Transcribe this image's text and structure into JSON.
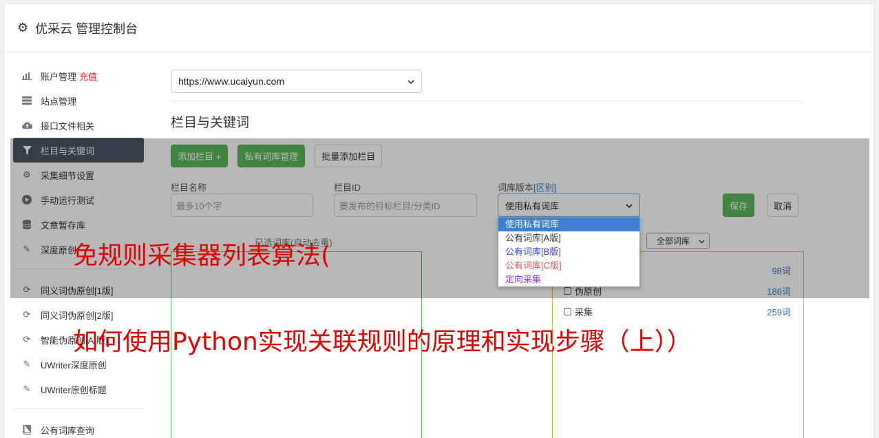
{
  "header": {
    "title": "优采云 管理控制台"
  },
  "sidebar": {
    "items": [
      {
        "label": "账户管理",
        "icon": "bar-chart-icon",
        "extra": "充值"
      },
      {
        "label": "站点管理",
        "icon": "server-icon"
      },
      {
        "label": "接口文件相关",
        "icon": "cloud-upload-icon"
      },
      {
        "label": "栏目与关键词",
        "icon": "filter-icon",
        "active": true
      },
      {
        "label": "采集细节设置",
        "icon": "cogs-icon"
      },
      {
        "label": "手动运行测试",
        "icon": "play-circle-icon"
      },
      {
        "label": "文章暂存库",
        "icon": "database-icon"
      },
      {
        "label": "深度原创",
        "icon": "edit-icon"
      }
    ],
    "items2": [
      {
        "label": "同义词伪原创[1版]",
        "icon": "refresh-icon"
      },
      {
        "label": "同义词伪原创[2版]",
        "icon": "refresh-icon"
      },
      {
        "label": "智能伪原创[AI版]",
        "icon": "refresh-icon"
      },
      {
        "label": "UWriter深度原创",
        "icon": "edit-icon"
      },
      {
        "label": "UWriter原创标题",
        "icon": "edit-icon"
      }
    ],
    "items3": [
      {
        "label": "公有词库查询",
        "icon": "book-icon"
      }
    ]
  },
  "main": {
    "site_select_value": "https://www.ucaiyun.com",
    "section_title": "栏目与关键词",
    "buttons": {
      "add_column": "添加栏目 +",
      "private_lib": "私有词库管理",
      "batch_add": "批量添加栏目"
    },
    "fields": {
      "column_name_label": "栏目名称",
      "column_name_placeholder": "最多10个字",
      "column_id_label": "栏目ID",
      "column_id_placeholder": "要发布的目标栏目/分类ID",
      "lib_version_label": "词库版本",
      "lib_version_link": "[区别]",
      "lib_version_value": "使用私有词库"
    },
    "save": "保存",
    "cancel": "取消",
    "dropdown_options": [
      {
        "label": "使用私有词库",
        "color": "#ffffff"
      },
      {
        "label": "公有词库[A版]",
        "color": "#333333"
      },
      {
        "label": "公有词库[B版]",
        "color": "#3a3adb"
      },
      {
        "label": "公有词库[C版]",
        "color": "#d9534f"
      },
      {
        "label": "定向采集",
        "color": "#9b30d9"
      }
    ],
    "selected_libs_label": "已选词库(自动去重)",
    "all_libs_select": "全部词库",
    "libs": [
      {
        "label": "",
        "count": "98词"
      },
      {
        "label": "伪原创",
        "count": "186词"
      },
      {
        "label": "采集",
        "count": "259词"
      }
    ]
  },
  "captions": {
    "line1": "免规则采集器列表算法(",
    "line2": "如何使用Python实现关联规则的原理和实现步骤（上））"
  }
}
